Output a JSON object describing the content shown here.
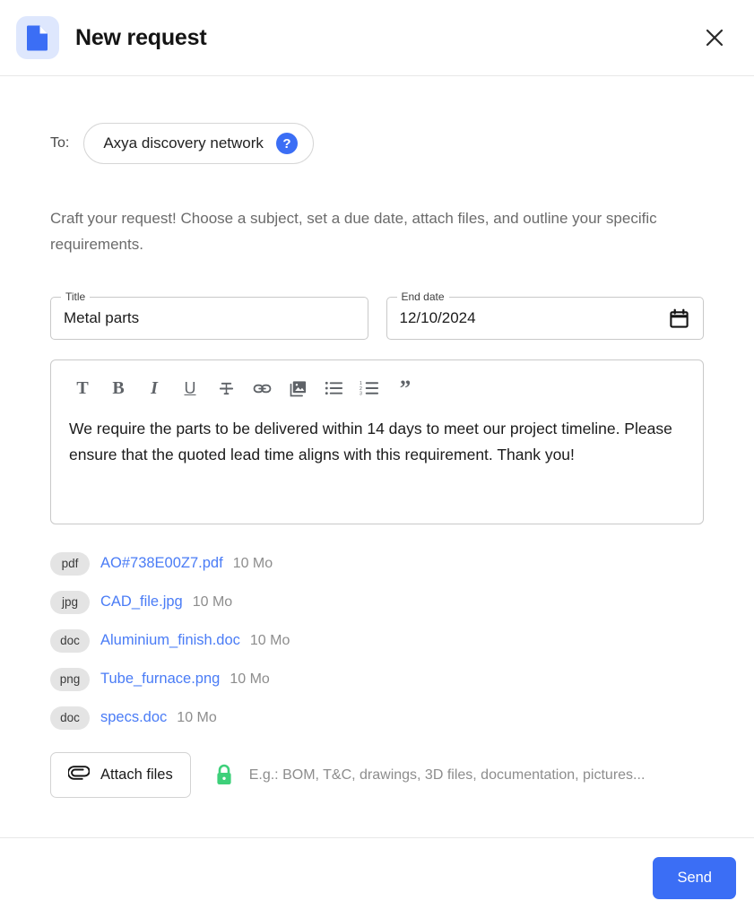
{
  "header": {
    "title": "New request",
    "doc_icon": "document-icon",
    "close_icon": "close-icon"
  },
  "recipient": {
    "to_label": "To:",
    "name": "Axya discovery network",
    "help_glyph": "?"
  },
  "intro_text": "Craft your request! Choose a subject, set a due date, attach files, and outline your specific requirements.",
  "fields": {
    "title": {
      "label": "Title",
      "value": "Metal parts"
    },
    "end_date": {
      "label": "End date",
      "value": "12/10/2024",
      "icon": "calendar-icon"
    }
  },
  "editor": {
    "toolbar": [
      {
        "name": "text-style-icon",
        "glyph": "T"
      },
      {
        "name": "bold-icon",
        "glyph": "B"
      },
      {
        "name": "italic-icon",
        "glyph": "I"
      },
      {
        "name": "underline-icon",
        "glyph": "U"
      },
      {
        "name": "strikethrough-icon",
        "glyph": ""
      },
      {
        "name": "link-icon",
        "glyph": ""
      },
      {
        "name": "image-icon",
        "glyph": ""
      },
      {
        "name": "bullet-list-icon",
        "glyph": ""
      },
      {
        "name": "numbered-list-icon",
        "glyph": ""
      },
      {
        "name": "quote-icon",
        "glyph": "”"
      }
    ],
    "body": "We require the parts to be delivered within 14 days to meet our project timeline. Please ensure that the quoted lead time aligns with this requirement. Thank you!"
  },
  "files": [
    {
      "ext": "pdf",
      "name": "AO#738E00Z7.pdf",
      "size": "10 Mo"
    },
    {
      "ext": "jpg",
      "name": "CAD_file.jpg",
      "size": "10 Mo"
    },
    {
      "ext": "doc",
      "name": "Aluminium_finish.doc",
      "size": "10 Mo"
    },
    {
      "ext": "png",
      "name": "Tube_furnace.png",
      "size": "10 Mo"
    },
    {
      "ext": "doc",
      "name": "specs.doc",
      "size": "10 Mo"
    }
  ],
  "attach": {
    "button_label": "Attach files",
    "clip_icon": "paperclip-icon",
    "lock_icon": "lock-icon",
    "hint": "E.g.: BOM, T&C, drawings, 3D files, documentation, pictures..."
  },
  "footer": {
    "send_label": "Send"
  },
  "colors": {
    "brand_blue": "#3b6ef5",
    "icon_bg_blue": "#dee7fd",
    "link_blue": "#4a7cf6",
    "lock_green": "#3ed07a",
    "badge_gray": "#e4e4e4",
    "muted_text": "#8d8d8d"
  }
}
